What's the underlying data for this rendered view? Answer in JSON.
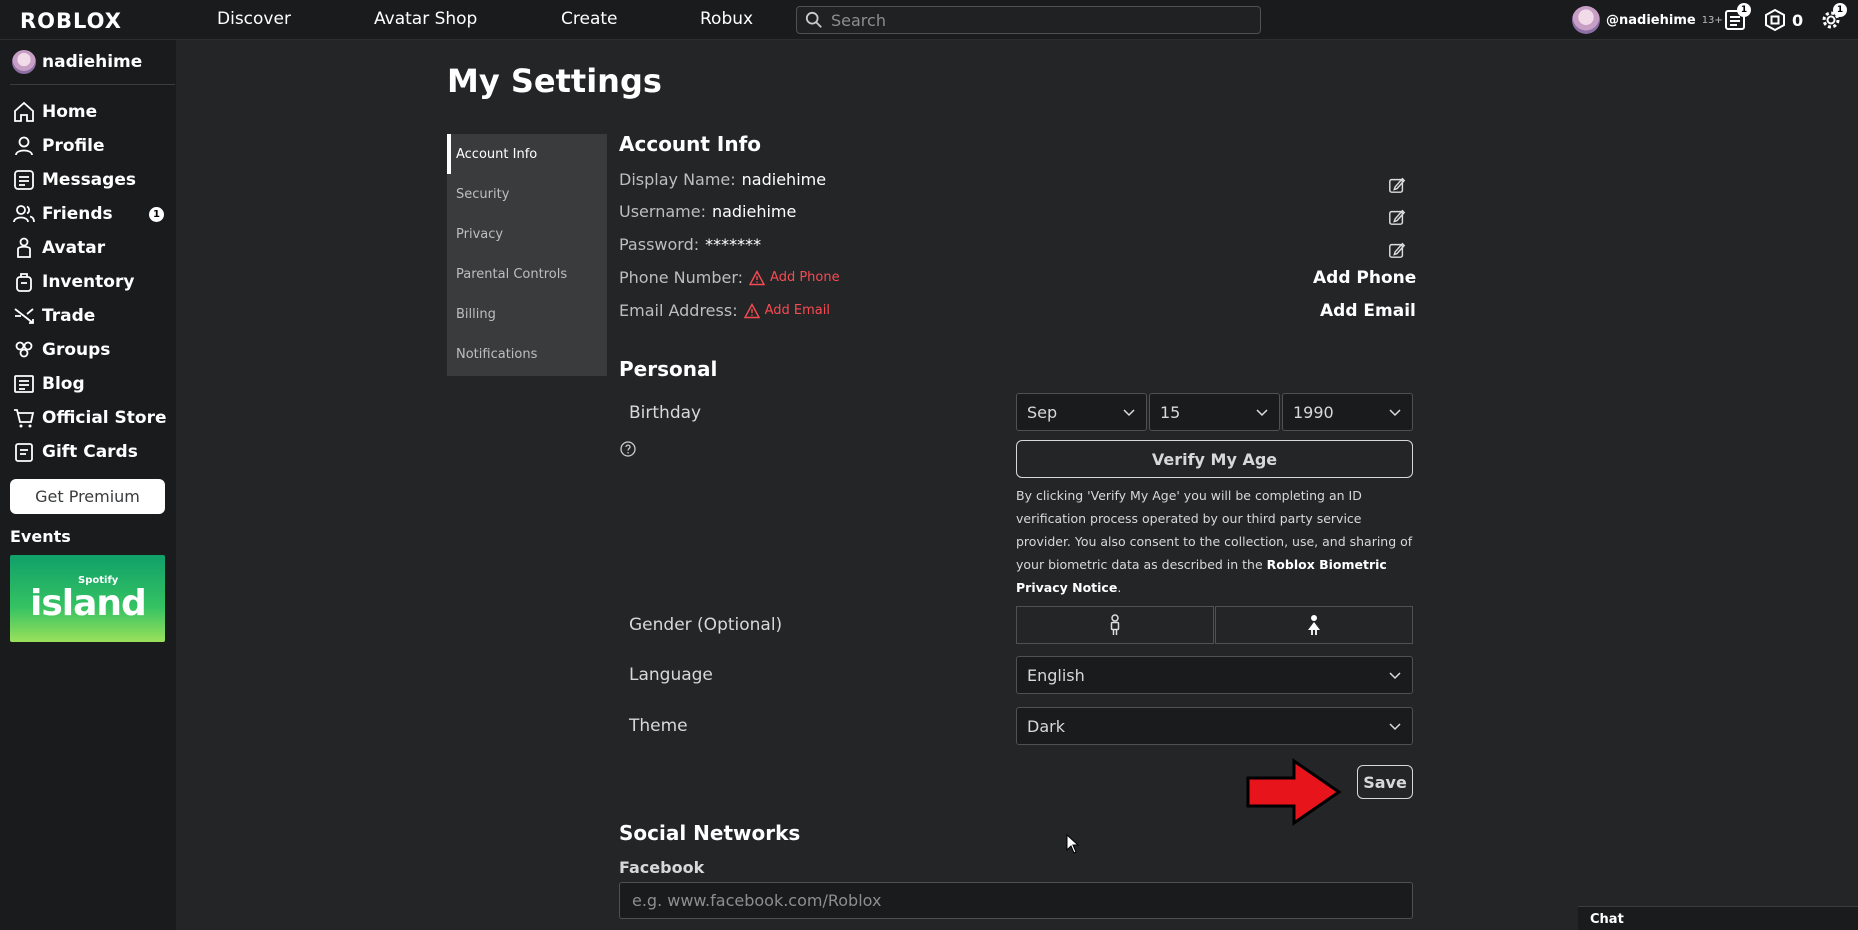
{
  "topnav": {
    "logo": "ROBLOX",
    "links": [
      "Discover",
      "Avatar Shop",
      "Create",
      "Robux"
    ],
    "search_placeholder": "Search",
    "username": "@nadiehime",
    "age_tag": "13+",
    "notifications_count": "1",
    "robux_amount": "0",
    "settings_badge": "1"
  },
  "sidebar": {
    "username": "nadiehime",
    "items": [
      {
        "label": "Home",
        "icon": "home-icon"
      },
      {
        "label": "Profile",
        "icon": "profile-icon"
      },
      {
        "label": "Messages",
        "icon": "messages-icon"
      },
      {
        "label": "Friends",
        "icon": "friends-icon",
        "badge": "1"
      },
      {
        "label": "Avatar",
        "icon": "avatar-icon"
      },
      {
        "label": "Inventory",
        "icon": "inventory-icon"
      },
      {
        "label": "Trade",
        "icon": "trade-icon"
      },
      {
        "label": "Groups",
        "icon": "groups-icon"
      },
      {
        "label": "Blog",
        "icon": "blog-icon"
      },
      {
        "label": "Official Store",
        "icon": "cart-icon"
      },
      {
        "label": "Gift Cards",
        "icon": "gift-card-icon"
      }
    ],
    "premium_label": "Get Premium",
    "events_label": "Events",
    "event_banner": {
      "brand": "Spotify",
      "title": "island"
    }
  },
  "page": {
    "title": "My Settings",
    "tabs": [
      "Account Info",
      "Security",
      "Privacy",
      "Parental Controls",
      "Billing",
      "Notifications"
    ],
    "active_tab": "Account Info"
  },
  "account_info": {
    "title": "Account Info",
    "display_name_label": "Display Name:",
    "display_name": "nadiehime",
    "username_label": "Username:",
    "username": "nadiehime",
    "password_label": "Password:",
    "password": "*******",
    "phone_label": "Phone Number:",
    "phone_warning": "Add Phone",
    "phone_action": "Add Phone",
    "email_label": "Email Address:",
    "email_warning": "Add Email",
    "email_action": "Add Email"
  },
  "personal": {
    "title": "Personal",
    "birthday_label": "Birthday",
    "birth_month": "Sep",
    "birth_day": "15",
    "birth_year": "1990",
    "verify_label": "Verify My Age",
    "disclaimer_text": "By clicking 'Verify My Age' you will be completing an ID verification process operated by our third party service provider. You also consent to the collection, use, and sharing of your biometric data as described in the ",
    "disclaimer_link": "Roblox Biometric Privacy Notice",
    "disclaimer_end": ".",
    "gender_label": "Gender (Optional)",
    "language_label": "Language",
    "language_value": "English",
    "theme_label": "Theme",
    "theme_value": "Dark",
    "save_label": "Save"
  },
  "social": {
    "title": "Social Networks",
    "facebook_label": "Facebook",
    "facebook_placeholder": "e.g. www.facebook.com/Roblox"
  },
  "chat": {
    "label": "Chat"
  },
  "colors": {
    "accent_red": "#e8141b",
    "warning_red": "#f74b52",
    "background": "#232527",
    "nav": "#191b1d"
  }
}
